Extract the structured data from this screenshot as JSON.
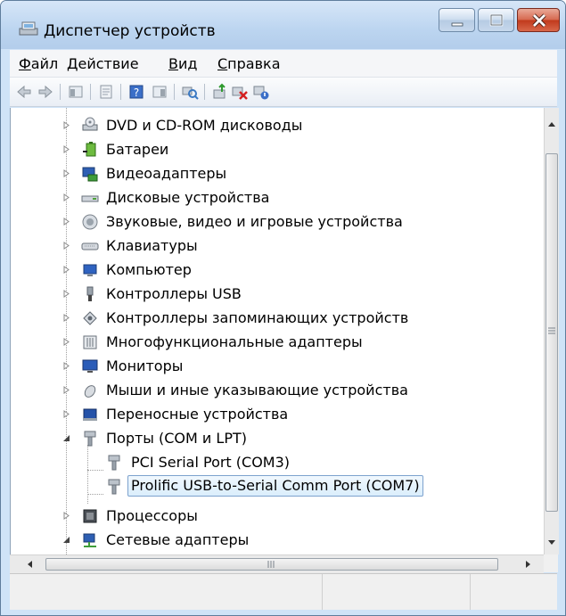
{
  "window": {
    "title": "Диспетчер устройств"
  },
  "menu": [
    {
      "label": "Файл"
    },
    {
      "label": "Действие"
    },
    {
      "label": "Вид"
    },
    {
      "label": "Справка"
    }
  ],
  "tree": [
    {
      "label": "DVD и CD-ROM дисководы",
      "icon": "dvd-drive-icon"
    },
    {
      "label": "Батареи",
      "icon": "battery-icon"
    },
    {
      "label": "Видеоадаптеры",
      "icon": "display-adapter-icon"
    },
    {
      "label": "Дисковые устройства",
      "icon": "disk-drive-icon"
    },
    {
      "label": "Звуковые, видео и игровые устройства",
      "icon": "speaker-icon"
    },
    {
      "label": "Клавиатуры",
      "icon": "keyboard-icon"
    },
    {
      "label": "Компьютер",
      "icon": "computer-icon"
    },
    {
      "label": "Контроллеры USB",
      "icon": "usb-icon"
    },
    {
      "label": "Контроллеры запоминающих устройств",
      "icon": "storage-controller-icon"
    },
    {
      "label": "Многофункциональные адаптеры",
      "icon": "multifunction-adapter-icon"
    },
    {
      "label": "Мониторы",
      "icon": "monitor-icon"
    },
    {
      "label": "Мыши и иные указывающие устройства",
      "icon": "mouse-icon"
    },
    {
      "label": "Переносные устройства",
      "icon": "portable-device-icon"
    },
    {
      "label": "Порты (COM и LPT)",
      "icon": "port-icon",
      "expanded": true
    },
    {
      "label": "PCI Serial Port (COM3)",
      "icon": "port-icon",
      "child": true
    },
    {
      "label": "Prolific USB-to-Serial Comm Port (COM7)",
      "icon": "port-icon",
      "child": true,
      "selected": true
    },
    {
      "label": "Процессоры",
      "icon": "processor-icon"
    },
    {
      "label": "Сетевые адаптеры",
      "icon": "network-adapter-icon",
      "expanded": true
    }
  ]
}
